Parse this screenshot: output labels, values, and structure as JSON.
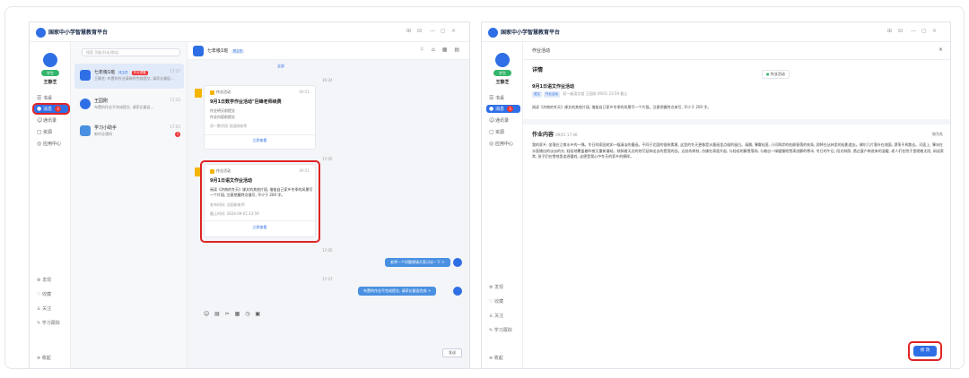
{
  "app": {
    "title": "国家中小学智慧教育平台",
    "controls": [
      "⊞",
      "⊟",
      "—",
      "▢",
      "×"
    ]
  },
  "user": {
    "role": "学生",
    "name": "王静芝"
  },
  "nav": [
    {
      "icon": "☰",
      "label": "书桌"
    },
    {
      "icon": "●",
      "label": "消息",
      "badge": "3"
    },
    {
      "icon": "☺",
      "label": "通讯录"
    },
    {
      "icon": "▢",
      "label": "资源"
    },
    {
      "icon": "◎",
      "label": "应用中心"
    }
  ],
  "bottom_nav": [
    {
      "icon": "⚙",
      "label": "发现"
    },
    {
      "icon": "♡",
      "label": "收藏"
    },
    {
      "icon": "♙",
      "label": "关注"
    },
    {
      "icon": "✎",
      "label": "学习跟踪"
    }
  ],
  "collapse": "≡ 收起",
  "search": {
    "placeholder": "搜索 功能/好友/群组"
  },
  "conversations": [
    {
      "name": "七年级1班",
      "tag1": "班主任",
      "tag2": "作业提醒",
      "msg": "王静芝: 布置的作业请按时完成提交, 请家长督促...",
      "time": "17:27"
    },
    {
      "name": "王园刚",
      "msg": "布置的作业不完成提交, 请家长督促...",
      "time": "17:25"
    },
    {
      "name": "学习小助手",
      "msg": "新作业通知",
      "time": "17:05",
      "badge": "1"
    }
  ],
  "chat": {
    "group_name": "七年级1班",
    "group_tag": "班主任",
    "header_icons": "⚐ ⌂ ▦ ▤",
    "top_link": "全部",
    "time1": "16:24",
    "card1": {
      "header": "作业活动",
      "time": "09:51",
      "title": "9月1日数学作业活动\"巨峰老师续费",
      "line1": "作业明天前提交",
      "line2": "作业内容前提交",
      "meta": "初一数学班 沈园刚老师",
      "btn": "立即查看"
    },
    "time2": "17:05",
    "card2": {
      "header": "作业活动",
      "time": "09:51",
      "title": "9月1日语文作业活动",
      "desc1": "阅读《济南的冬天》课文的其他片段, 借鉴自己家乡冬季的风景写",
      "desc2": "一个片段, 注意把握特点描写, 不少于 200 字。",
      "meta1": "发布时间: 沈园刚老师",
      "meta2": "截止时间: 2024-09-01 23:59",
      "btn": "立即查看"
    },
    "time3": "17:05",
    "bubble1": "老师一个问题想请大家讨论一下 >",
    "time4": "17:27",
    "bubble2": "布置的作业不完成提交, 请家长督促完成 >",
    "toolbar": "☺ ▤ ✂ ▦ ◷ ▣",
    "send": "发送"
  },
  "detail": {
    "header": "作业活动",
    "section1": "详情",
    "toast": "作业活动",
    "title": "9月1日语文作业活动",
    "tag1": "语文",
    "tag2": "作业活动",
    "meta": "初一级语文组  王园刚  09/01 23:59 截止",
    "body1": "阅读《济南的冬天》课文的其他片段, 借鉴自己家乡冬季的风景写一个片段。注意把握特点来写, 不少于 200 字。",
    "section2": "作业内容",
    "section2_time": "09/01 17:46",
    "section2_link": "较为先",
    "content": "我的家乡, 坐落在江南水乡的一隅。冬日的家园宛如一幅清淡的墨画。不同于北国的银装素裹, 这里的冬天更像是水墨画里点缀的留白。清晨, 薄雾轻笼, 小河两岸的枯柳垂落的枝条, 即将在丛林里的轻影遮去。偶尔几片落叶在湖面, 漂荡不肯散去。河面上, 薄冰在水面铺出的淡淡的光, 轻轻地覆盖着昨夜又重新凝结。倾斜着天边的苍茫延伸出去的是我的田。远处的树枝, 仿佛在表面升起, 与轻轻的飘雪落场, 与着自一绿缓慢地雪滴进静的寒冰, 冬日的午后, 阳光斜照, 透过窗户映进来的温暖, 老人们在院子里晒着太阳, 闲谈家常, 孩子们在雪地里追逐嬉戏, 这便是我心中冬天的家乡的模样。",
    "modify": "修 改"
  },
  "colors": {
    "accent": "#2f6fe6",
    "highlight": "#e02424",
    "success": "#33b56b"
  }
}
